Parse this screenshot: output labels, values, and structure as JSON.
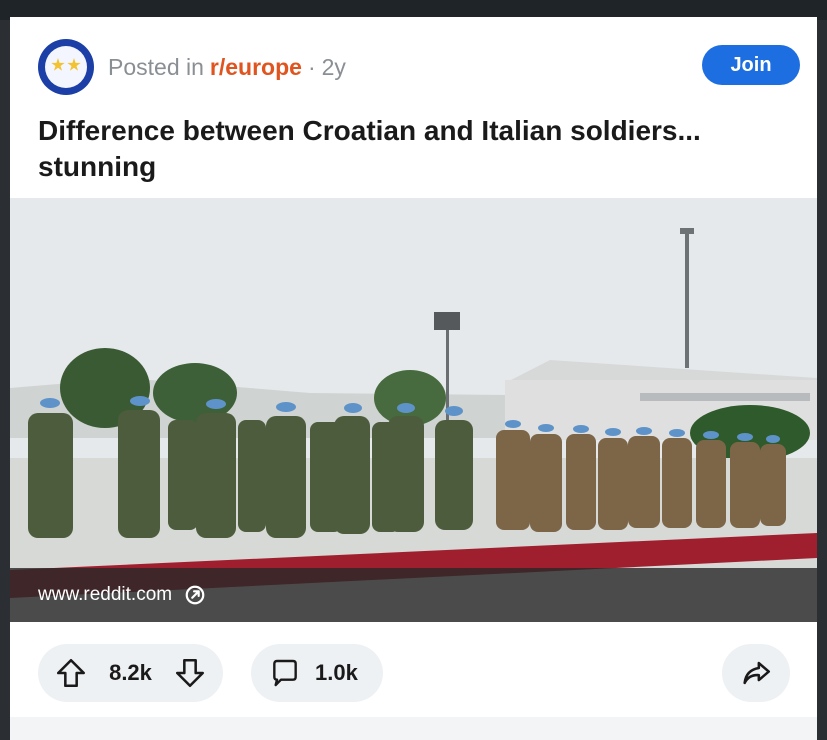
{
  "post": {
    "posted_in_label": "Posted in",
    "subreddit": "r/europe",
    "separator": "·",
    "age": "2y",
    "join_label": "Join",
    "title": "Difference between Croatian and Italian soldiers... stunning",
    "link_domain": "www.reddit.com",
    "upvotes": "8.2k",
    "comments": "1.0k"
  },
  "colors": {
    "accent": "#1d6ee0",
    "subreddit": "#e0541f"
  },
  "icons": {
    "avatar": "subreddit-avatar-icon",
    "external": "external-link-icon",
    "upvote": "upvote-arrow-icon",
    "downvote": "downvote-arrow-icon",
    "comment": "comment-bubble-icon",
    "share": "share-arrow-icon"
  }
}
